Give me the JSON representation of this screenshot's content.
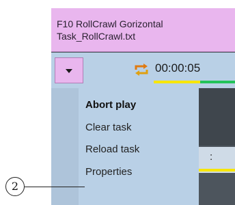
{
  "title": {
    "line1": "F10 RollCrawl Gorizontal",
    "line2": "Task_RollCrawl.txt"
  },
  "controls": {
    "dropdown_icon": "caret-down-icon",
    "loop_icon": "loop-arrows-icon",
    "timecode": "00:00:05"
  },
  "menu": {
    "items": [
      {
        "label": "Abort play"
      },
      {
        "label": "Clear task"
      },
      {
        "label": "Reload task"
      },
      {
        "label": "Properties"
      }
    ]
  },
  "background": {
    "field_text": ":"
  },
  "callout": {
    "number": "2"
  },
  "colors": {
    "title_bg": "#e9b6ee",
    "menu_bg": "#b9d0e6",
    "panel_bg": "#4a525a",
    "timecode_yellow": "#f7e600",
    "timecode_green": "#22c35a"
  }
}
